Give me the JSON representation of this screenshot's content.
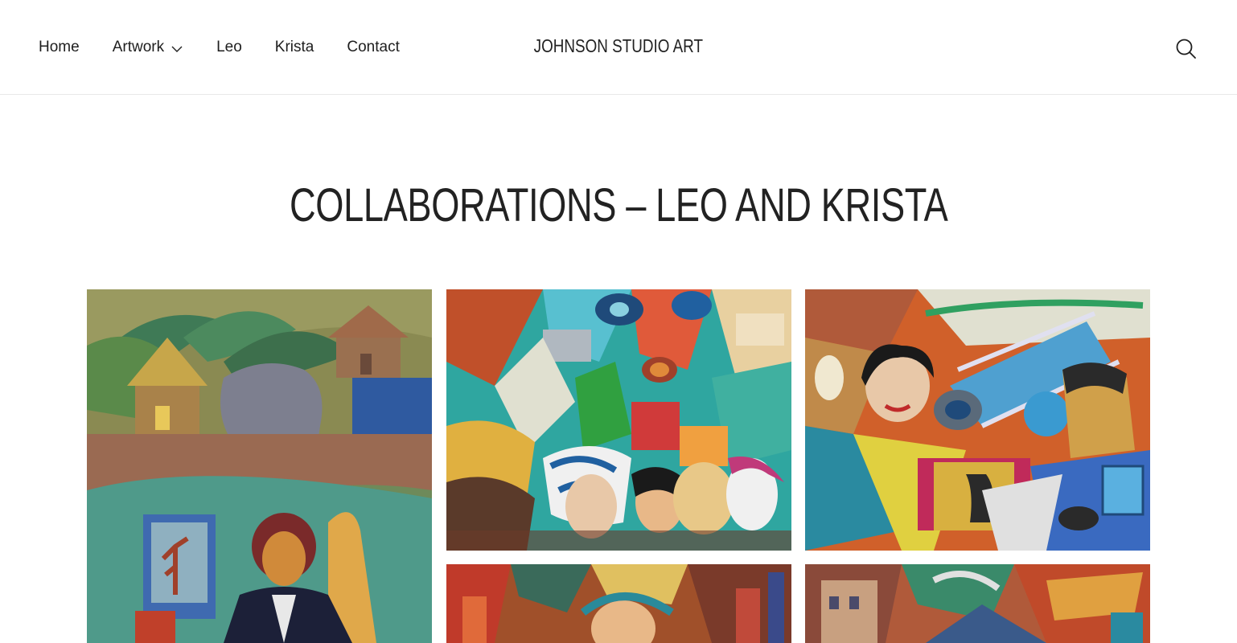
{
  "nav": {
    "items": [
      {
        "label": "Home"
      },
      {
        "label": "Artwork"
      },
      {
        "label": "Leo"
      },
      {
        "label": "Krista"
      },
      {
        "label": "Contact"
      }
    ]
  },
  "site": {
    "title": "JOHNSON STUDIO ART"
  },
  "page": {
    "title": "COLLABORATIONS – LEO AND KRISTA"
  },
  "icons": {
    "search": "search-icon",
    "dropdown": "chevron-down-icon"
  },
  "gallery": {
    "items": [
      {
        "name": "painting-elephant-village"
      },
      {
        "name": "painting-abstract-faces-city"
      },
      {
        "name": "painting-portraits-bridge"
      },
      {
        "name": "painting-abstract-partial-1"
      },
      {
        "name": "painting-abstract-partial-2"
      }
    ]
  }
}
